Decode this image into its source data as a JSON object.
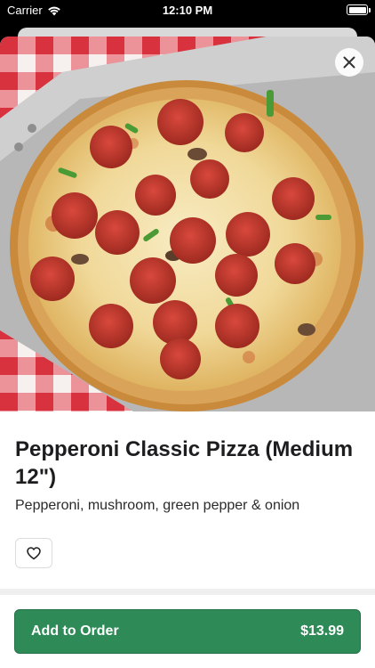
{
  "status_bar": {
    "carrier": "Carrier",
    "time": "12:10 PM"
  },
  "product": {
    "name": "Pepperoni Classic Pizza (Medium 12\")",
    "description": "Pepperoni, mushroom, green pepper & onion",
    "image_icon": "pizza-photo"
  },
  "actions": {
    "close_icon": "close-icon",
    "favorite_icon": "heart-outline-icon",
    "add_label": "Add to Order",
    "price": "$13.99"
  },
  "colors": {
    "accent": "#2e8b57",
    "text": "#1d1d1f",
    "tablecloth_red": "#d8323f",
    "crust": "#c98a3c"
  }
}
